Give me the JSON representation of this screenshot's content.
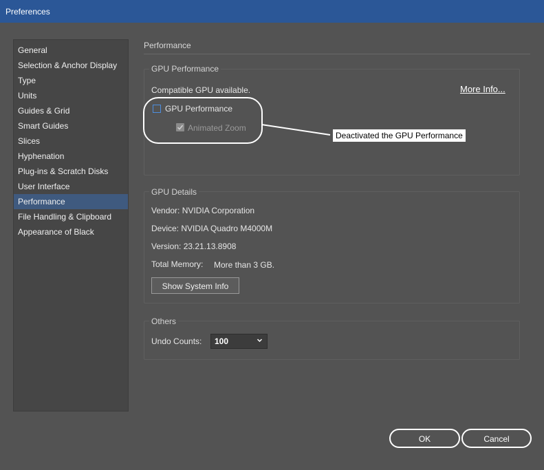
{
  "window": {
    "title": "Preferences"
  },
  "sidebar": {
    "items": [
      {
        "label": "General"
      },
      {
        "label": "Selection & Anchor Display"
      },
      {
        "label": "Type"
      },
      {
        "label": "Units"
      },
      {
        "label": "Guides & Grid"
      },
      {
        "label": "Smart Guides"
      },
      {
        "label": "Slices"
      },
      {
        "label": "Hyphenation"
      },
      {
        "label": "Plug-ins & Scratch Disks"
      },
      {
        "label": "User Interface"
      },
      {
        "label": "Performance",
        "selected": true
      },
      {
        "label": "File Handling & Clipboard"
      },
      {
        "label": "Appearance of Black"
      }
    ]
  },
  "main": {
    "section_title": "Performance",
    "gpu_performance": {
      "group_title": "GPU Performance",
      "status": "Compatible GPU available.",
      "more_info": "More Info...",
      "gpu_checkbox": {
        "label": "GPU Performance",
        "checked": false
      },
      "animated_zoom": {
        "label": "Animated Zoom",
        "checked": true,
        "enabled": false
      }
    },
    "gpu_details": {
      "group_title": "GPU Details",
      "vendor": "Vendor: NVIDIA Corporation",
      "device": "Device: NVIDIA Quadro M4000M",
      "version": "Version: 23.21.13.8908",
      "memory_label": "Total Memory:",
      "memory_value": "More than 3 GB.",
      "show_system_info": "Show System Info"
    },
    "others": {
      "group_title": "Others",
      "undo_label": "Undo Counts:",
      "undo_value": "100"
    }
  },
  "footer": {
    "ok_label": "OK",
    "cancel_label": "Cancel"
  },
  "annotation": {
    "text": "Deactivated the GPU Performance"
  },
  "colors": {
    "titlebar": "#2b5797",
    "dialog_bg": "#535353",
    "selected_item": "#3f5a7f",
    "checkbox_border": "#4d8fe0"
  }
}
